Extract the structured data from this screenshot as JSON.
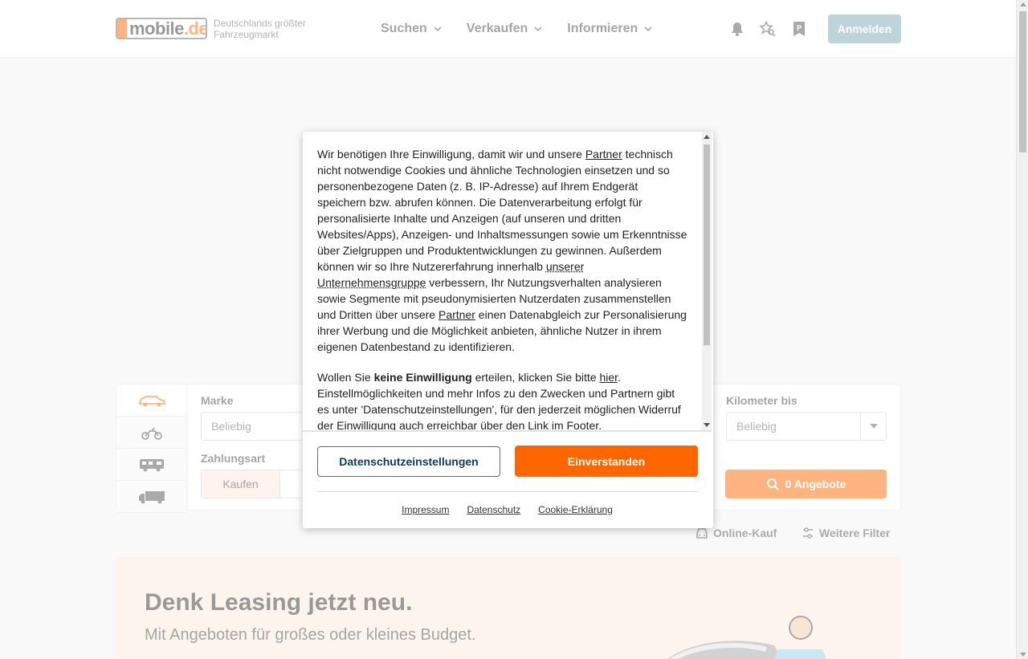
{
  "brand": {
    "logo_text": "mobile",
    "logo_tld": ".de",
    "tagline": "Deutschlands größter Fahrzeugmarkt",
    "accent_color": "#ff6600"
  },
  "nav": {
    "items": [
      {
        "label": "Suchen"
      },
      {
        "label": "Verkaufen"
      },
      {
        "label": "Informieren"
      }
    ],
    "icons": [
      "bell-icon",
      "star-search-icon",
      "parking-icon"
    ],
    "login_label": "Anmelden"
  },
  "search": {
    "vehicle_tabs": [
      "car-icon",
      "motorcycle-icon",
      "camper-icon",
      "truck-icon"
    ],
    "make_label": "Marke",
    "make_value": "Beliebig",
    "payment_label": "Zahlungsart",
    "payment_options": [
      "Kaufen"
    ],
    "km_label": "Kilometer bis",
    "km_value": "Beliebig",
    "offers_button": "0 Angebote",
    "online_purchase": "Online-Kauf",
    "more_filters": "Weitere Filter"
  },
  "promo": {
    "title": "Denk Leasing jetzt neu.",
    "subtitle": "Mit Angeboten für großes oder kleines Budget."
  },
  "consent": {
    "p1_a": "Wir benötigen Ihre Einwilligung, damit wir und unsere ",
    "p1_link1": "Partner",
    "p1_b": " technisch nicht notwendige Cookies und ähnliche Technologien einsetzen und so personenbezogene Daten (z. B. IP-Adresse) auf Ihrem Endgerät speichern bzw. abrufen können. Die Datenverarbeitung erfolgt für personalisierte Inhalte und Anzeigen (auf unseren und dritten Websites/Apps), Anzeigen- und Inhaltsmessungen sowie um Erkenntnisse über Zielgruppen und Produktentwicklungen zu gewinnen. Außerdem können wir so Ihre Nutzererfahrung innerhalb ",
    "p1_link2": "unserer Unternehmensgruppe",
    "p1_c": " verbessern, Ihr Nutzungsverhalten analysieren sowie Segmente mit pseudonymisierten Nutzerdaten zusammenstellen und Dritten über unsere ",
    "p1_link3": "Partner",
    "p1_d": " einen Datenabgleich zur Personalisierung ihrer Werbung und die Möglichkeit anbieten, ähnliche Nutzer in ihrem eigenen Datenbestand zu identifizieren.",
    "p2_a": "Wollen Sie ",
    "p2_bold": "keine Einwilligung",
    "p2_b": " erteilen, klicken Sie bitte ",
    "p2_link": "hier",
    "p2_c": ". Einstellmöglichkeiten und mehr Infos zu den Zwecken und Partnern gibt es unter 'Datenschutzeinstellungen', für den jederzeit möglichen Widerruf der Einwilligung auch erreichbar über den Link im Footer.",
    "settings_button": "Datenschutzeinstellungen",
    "accept_button": "Einverstanden",
    "footer_links": [
      "Impressum",
      "Datenschutz",
      "Cookie-Erklärung"
    ]
  }
}
